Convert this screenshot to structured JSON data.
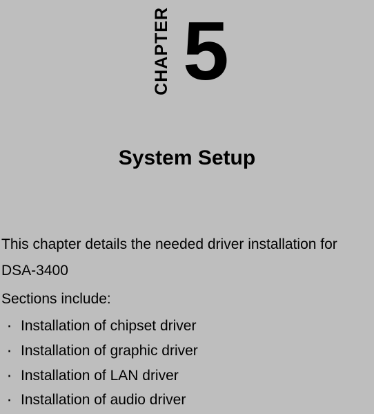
{
  "chapter": {
    "label": "CHAPTER",
    "number": "5",
    "title": "System Setup"
  },
  "intro": {
    "text": "This chapter details the needed driver installation for DSA-3400",
    "sections_label": "Sections include:"
  },
  "bullets": [
    "Installation of chipset driver",
    "Installation of graphic driver",
    "Installation of LAN driver",
    "Installation of audio driver"
  ]
}
